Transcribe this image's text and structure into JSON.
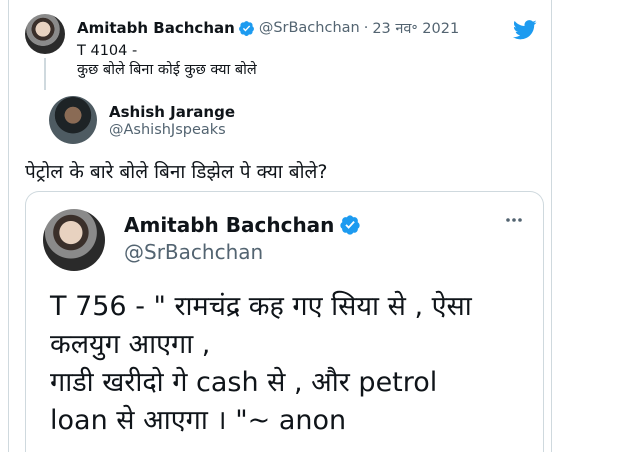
{
  "parent_tweet": {
    "name": "Amitabh Bachchan",
    "handle": "@SrBachchan",
    "separator": "·",
    "date": "23 नव॰ 2021",
    "line1": "T 4104 -",
    "line2": "कुछ बोले बिना कोई कुछ क्या बोले"
  },
  "reply": {
    "name": "Ashish Jarange",
    "handle": "@AshishJspeaks",
    "text": "पेट्रोल के बारे बोले बिना डिझेल पे क्या बोले?"
  },
  "media_tweet": {
    "name": "Amitabh Bachchan",
    "handle": "@SrBachchan",
    "lines": [
      "T 756 - \" रामचंद्र कह गए सिया से , ऐसा",
      "कलयुग आएगा ,",
      "गाडी खरीदो गे cash से , और petrol",
      "loan से आएगा  । \"~ anon"
    ]
  },
  "icons": {
    "brand": "twitter-bird-icon",
    "verified": "verified-badge-icon",
    "more": "more-options-icon"
  },
  "colors": {
    "brand_blue": "#1d9bf0",
    "muted": "#536471",
    "border": "#cfd9de"
  }
}
